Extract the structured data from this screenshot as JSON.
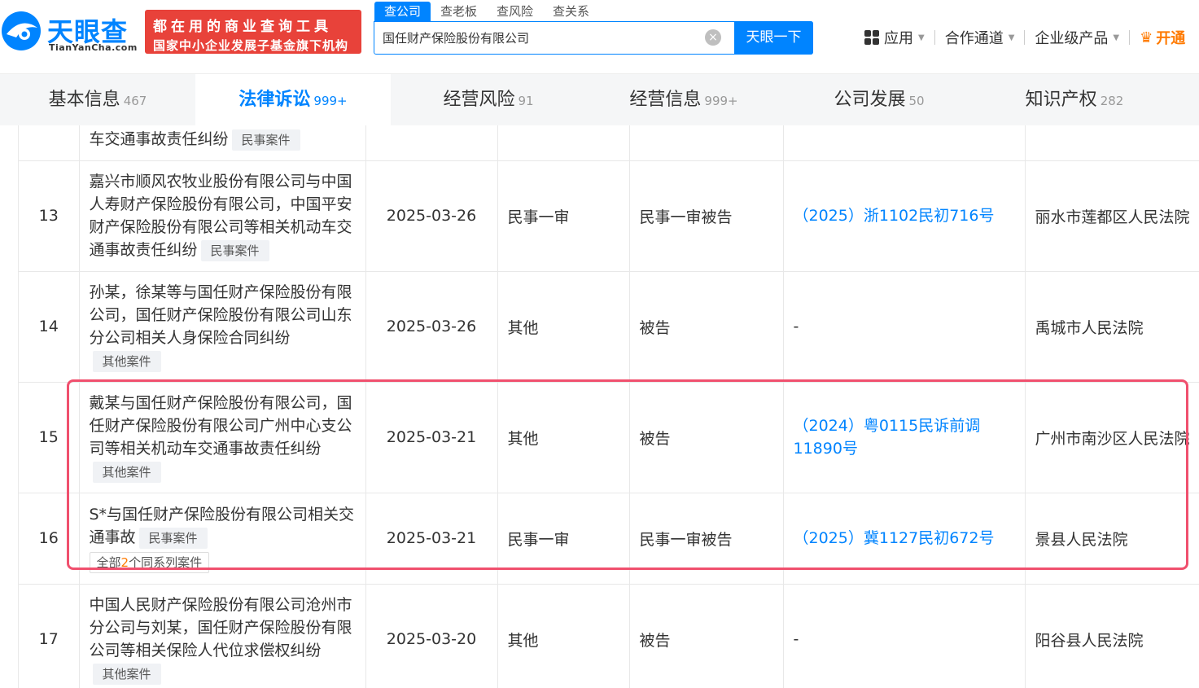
{
  "header": {
    "logo_cn": "天眼查",
    "logo_en": "TianYanCha.com",
    "slogan_line1": "都在用的商业查询工具",
    "slogan_line2": "国家中小企业发展子基金旗下机构",
    "search_tabs": [
      "查公司",
      "查老板",
      "查风险",
      "查关系"
    ],
    "search_value": "国任财产保险股份有限公司",
    "search_button": "天眼一下",
    "nav": {
      "apps": "应用",
      "cooperation": "合作通道",
      "enterprise": "企业级产品",
      "vip": "开通"
    }
  },
  "tabs": [
    {
      "label": "基本信息",
      "count": "467"
    },
    {
      "label": "法律诉讼",
      "count": "999+"
    },
    {
      "label": "经营风险",
      "count": "91"
    },
    {
      "label": "经营信息",
      "count": "999+"
    },
    {
      "label": "公司发展",
      "count": "50"
    },
    {
      "label": "知识产权",
      "count": "282"
    }
  ],
  "rows": [
    {
      "index": "",
      "case": "车交通事故责任纠纷",
      "tag": "民事案件",
      "date": "",
      "stage": "",
      "role": "",
      "number": "",
      "court": ""
    },
    {
      "index": "13",
      "case": "嘉兴市顺风农牧业股份有限公司与中国人寿财产保险股份有限公司，中国平安财产保险股份有限公司等相关机动车交通事故责任纠纷",
      "tag": "民事案件",
      "date": "2025-03-26",
      "stage": "民事一审",
      "role": "民事一审被告",
      "number": "（2025）浙1102民初716号",
      "court": "丽水市莲都区人民法院"
    },
    {
      "index": "14",
      "case": "孙某，徐某等与国任财产保险股份有限公司，国任财产保险股份有限公司山东分公司相关人身保险合同纠纷",
      "tag": "其他案件",
      "date": "2025-03-26",
      "stage": "其他",
      "role": "被告",
      "number": "-",
      "court": "禹城市人民法院"
    },
    {
      "index": "15",
      "case": "戴某与国任财产保险股份有限公司，国任财产保险股份有限公司广州中心支公司等相关机动车交通事故责任纠纷",
      "tag": "其他案件",
      "date": "2025-03-21",
      "stage": "其他",
      "role": "被告",
      "number": "（2024）粤0115民诉前调11890号",
      "court": "广州市南沙区人民法院"
    },
    {
      "index": "16",
      "case": "S*与国任财产保险股份有限公司相关交通事故",
      "tag": "民事案件",
      "series_prefix": "全部",
      "series_count": "2",
      "series_suffix": "个同系列案件",
      "date": "2025-03-21",
      "stage": "民事一审",
      "role": "民事一审被告",
      "number": "（2025）冀1127民初672号",
      "court": "景县人民法院"
    },
    {
      "index": "17",
      "case": "中国人民财产保险股份有限公司沧州市分公司与刘某，国任财产保险股份有限公司等相关保险人代位求偿权纠纷",
      "tag": "其他案件",
      "date": "2025-03-20",
      "stage": "其他",
      "role": "被告",
      "number": "-",
      "court": "阳谷县人民法院"
    }
  ]
}
